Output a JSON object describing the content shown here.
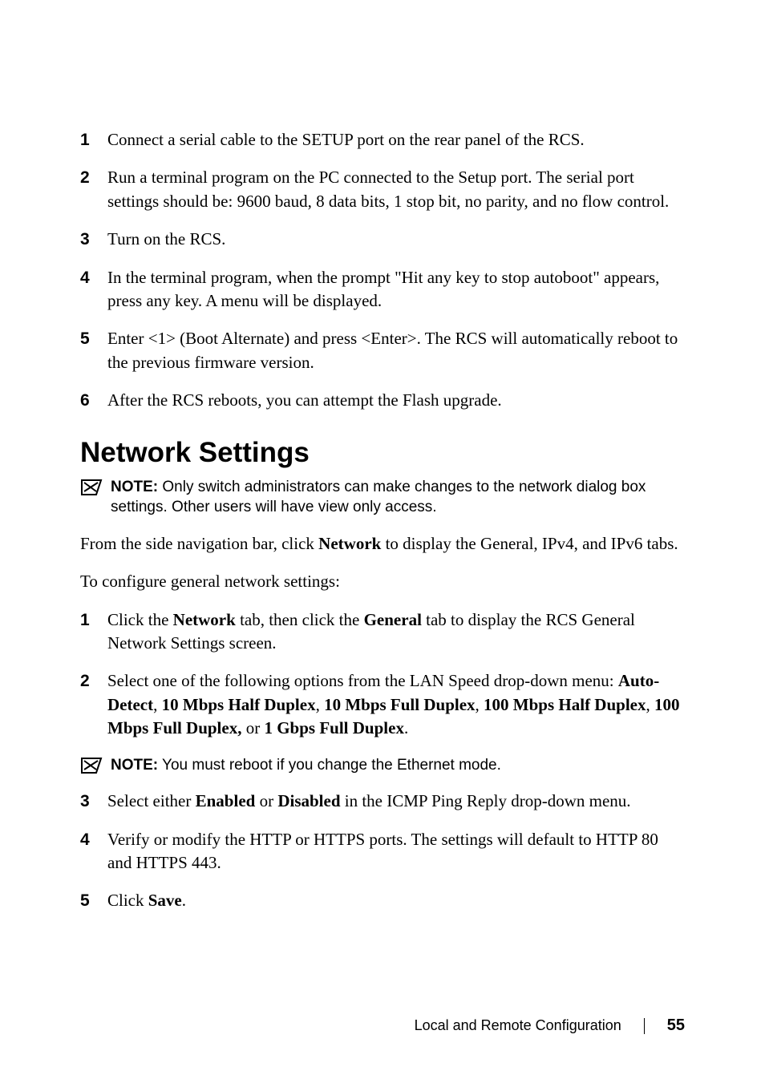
{
  "steps_a": [
    {
      "num": "1",
      "text": "Connect a serial cable to the SETUP port on the rear panel of the RCS."
    },
    {
      "num": "2",
      "text": "Run a terminal program on the PC connected to the Setup port. The serial port settings should be: 9600 baud, 8 data bits, 1 stop bit, no parity, and no flow control."
    },
    {
      "num": "3",
      "text": "Turn on the RCS."
    },
    {
      "num": "4",
      "text": "In the terminal program, when the prompt \"Hit any key to stop autoboot\" appears, press any key. A menu will be displayed."
    },
    {
      "num": "5",
      "text": "Enter <1> (Boot Alternate) and press <Enter>. The RCS will automatically reboot to the previous firmware version."
    },
    {
      "num": "6",
      "text": "After the RCS reboots, you can attempt the Flash upgrade."
    }
  ],
  "heading": "Network Settings",
  "note1": {
    "label": "NOTE:",
    "text": " Only switch administrators can make changes to the network dialog box settings. Other users will have view only access."
  },
  "para1": {
    "pre": "From the side navigation bar, click ",
    "bold": "Network",
    "post": " to display the General, IPv4, and IPv6 tabs."
  },
  "para2": "To configure general network settings:",
  "steps_b": {
    "1": {
      "num": "1",
      "pre": "Click the ",
      "b1": "Network",
      "mid1": " tab, then click the ",
      "b2": "General",
      "post": " tab to display the RCS General Network Settings screen."
    },
    "2": {
      "num": "2",
      "pre": "Select one of the following options from the LAN Speed drop-down menu: ",
      "b1": "Auto-Detect",
      "s1": ", ",
      "b2": "10 Mbps Half Duplex",
      "s2": ", ",
      "b3": "10 Mbps Full Duplex",
      "s3": ", ",
      "b4": "100 Mbps Half Duplex",
      "s4": ", ",
      "b5": "100 Mbps Full Duplex,",
      "s5": " or ",
      "b6": "1 Gbps Full Duplex",
      "post": "."
    },
    "3": {
      "num": "3",
      "pre": "Select either ",
      "b1": "Enabled",
      "mid": " or ",
      "b2": "Disabled",
      "post": " in the ICMP Ping Reply drop-down menu."
    },
    "4": {
      "num": "4",
      "text": "Verify or modify the HTTP or HTTPS ports. The settings will default to HTTP 80 and HTTPS 443."
    },
    "5": {
      "num": "5",
      "pre": "Click ",
      "b1": "Save",
      "post": "."
    }
  },
  "note2": {
    "label": "NOTE:",
    "text": " You must reboot if you change the Ethernet mode."
  },
  "footer": {
    "title": "Local and Remote Configuration",
    "page": "55"
  }
}
